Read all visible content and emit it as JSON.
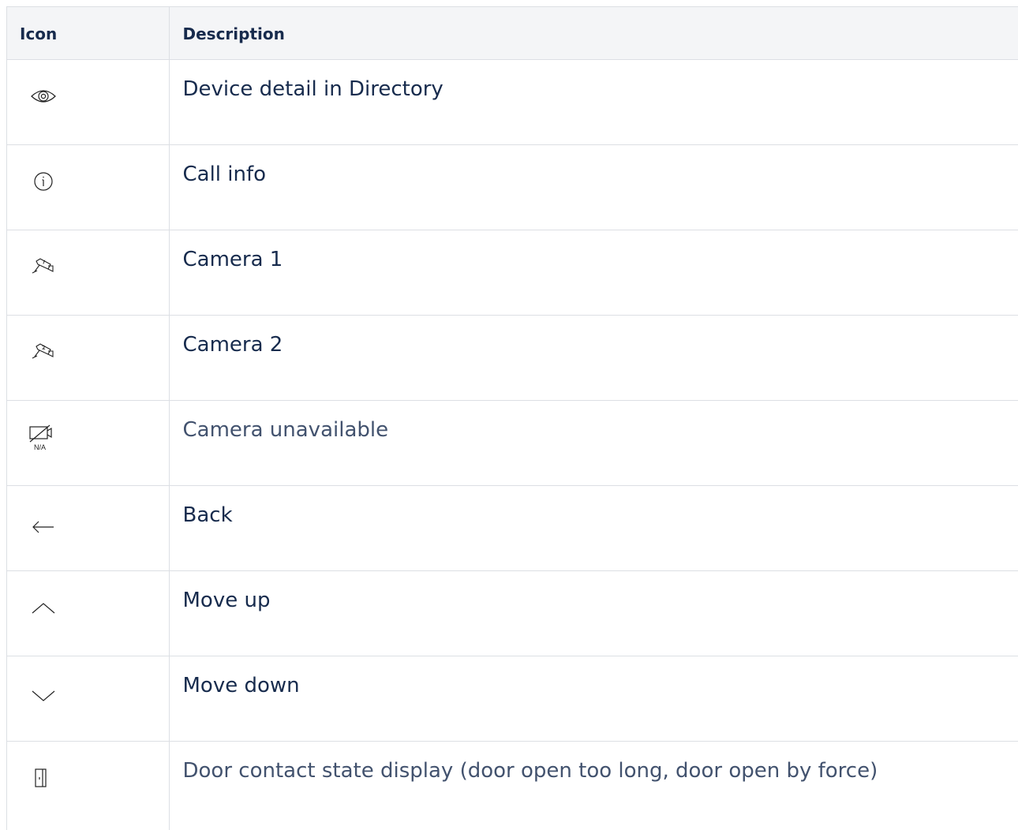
{
  "table": {
    "headers": {
      "icon": "Icon",
      "description": "Description"
    },
    "rows": [
      {
        "icon": "eye-icon",
        "description": "Device detail in Directory"
      },
      {
        "icon": "info-circle-icon",
        "description": "Call info"
      },
      {
        "icon": "camera-1-icon",
        "description": "Camera 1"
      },
      {
        "icon": "camera-2-icon",
        "description": "Camera 2"
      },
      {
        "icon": "camera-unavailable-icon",
        "icon_label": "N/A",
        "description": "Camera unavailable"
      },
      {
        "icon": "arrow-left-icon",
        "description": "Back"
      },
      {
        "icon": "chevron-up-icon",
        "description": "Move up"
      },
      {
        "icon": "chevron-down-icon",
        "description": "Move down"
      },
      {
        "icon": "door-contact-icon",
        "description": "Door contact state display (door open too long, door open by force)"
      }
    ]
  }
}
